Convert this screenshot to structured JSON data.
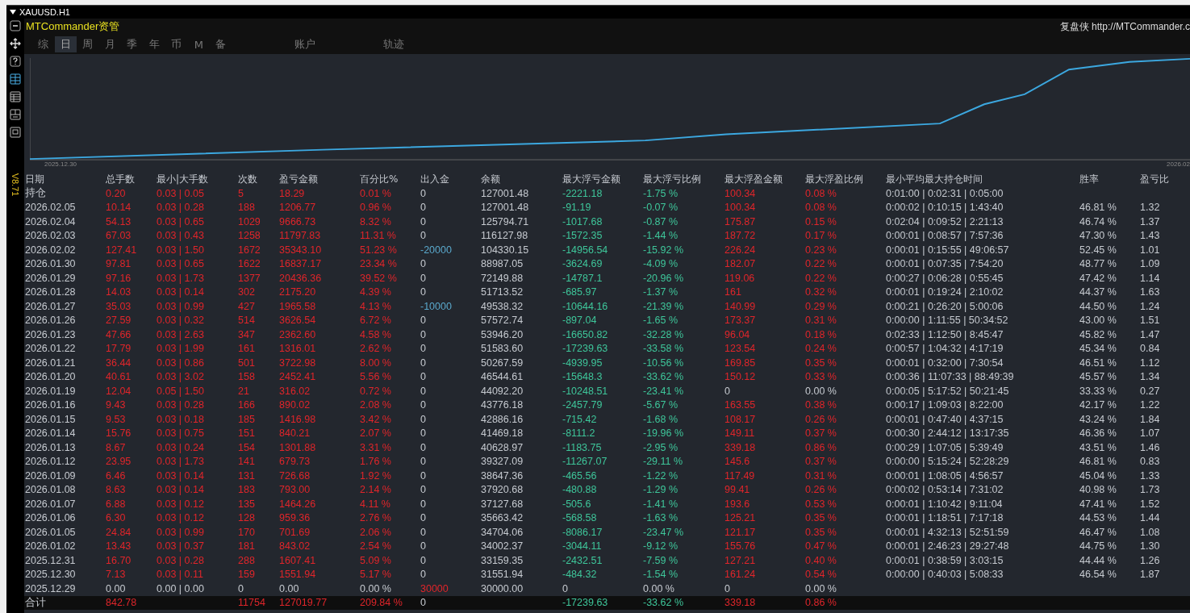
{
  "window": {
    "title": "XAUUSD.H1"
  },
  "panel": {
    "title": "MTCommander资管",
    "brand": "复盘侠 http://MTCommander.c",
    "version": "V8.71"
  },
  "tabs": [
    {
      "label": "综",
      "selected": false
    },
    {
      "label": "日",
      "selected": true
    },
    {
      "label": "周",
      "selected": false
    },
    {
      "label": "月",
      "selected": false
    },
    {
      "label": "季",
      "selected": false
    },
    {
      "label": "年",
      "selected": false
    },
    {
      "label": "币",
      "selected": false
    },
    {
      "label": "M",
      "selected": false
    },
    {
      "label": "备",
      "selected": false
    }
  ],
  "sections": [
    {
      "label": "账户",
      "selected": false
    },
    {
      "label": "轨迹",
      "selected": false
    }
  ],
  "chart": {
    "start_label": "2025.12.30",
    "end_label": "2026.02"
  },
  "table": {
    "columns": [
      "日期",
      "总手数",
      "最小|大手数",
      "次数",
      "盈亏金额",
      "百分比%",
      "出入金",
      "余额",
      "最大浮亏金额",
      "最大浮亏比例",
      "最大浮盈金额",
      "最大浮盈比例",
      "最小平均最大持仓时间",
      "胜率",
      "盈亏比"
    ],
    "rows": [
      {
        "kind": "open",
        "profit": true,
        "float_loss": true,
        "float_gain": true,
        "withdrawal": false,
        "deposit": false,
        "cells": [
          "持仓",
          "0.20",
          "0.03 | 0.05",
          "5",
          "18.29",
          "0.01 %",
          "0",
          "127001.48",
          "-2221.18",
          "-1.75 %",
          "100.34",
          "0.08 %",
          "0:01:00 | 0:02:31 | 0:05:00",
          null,
          null
        ]
      },
      {
        "kind": "day",
        "profit": true,
        "float_loss": true,
        "float_gain": true,
        "withdrawal": false,
        "deposit": false,
        "cells": [
          "2026.02.05",
          "10.14",
          "0.03 | 0.28",
          "188",
          "1206.77",
          "0.96 %",
          "0",
          "127001.48",
          "-91.19",
          "-0.07 %",
          "100.34",
          "0.08 %",
          "0:00:02 | 0:10:15 | 1:43:40",
          "46.81 %",
          "1.32"
        ]
      },
      {
        "kind": "day",
        "profit": true,
        "float_loss": true,
        "float_gain": true,
        "withdrawal": false,
        "deposit": false,
        "cells": [
          "2026.02.04",
          "54.13",
          "0.03 | 0.65",
          "1029",
          "9666.73",
          "8.32 %",
          "0",
          "125794.71",
          "-1017.68",
          "-0.87 %",
          "175.87",
          "0.15 %",
          "0:02:04 | 0:09:52 | 2:21:13",
          "46.74 %",
          "1.37"
        ]
      },
      {
        "kind": "day",
        "profit": true,
        "float_loss": true,
        "float_gain": true,
        "withdrawal": false,
        "deposit": false,
        "cells": [
          "2026.02.03",
          "67.03",
          "0.03 | 0.43",
          "1258",
          "11797.83",
          "11.31 %",
          "0",
          "116127.98",
          "-1572.35",
          "-1.44 %",
          "187.72",
          "0.17 %",
          "0:00:01 | 0:08:57 | 7:57:36",
          "47.30 %",
          "1.43"
        ]
      },
      {
        "kind": "day",
        "profit": true,
        "float_loss": true,
        "float_gain": true,
        "withdrawal": true,
        "deposit": false,
        "cells": [
          "2026.02.02",
          "127.41",
          "0.03 | 1.50",
          "1672",
          "35343.10",
          "51.23 %",
          "-20000",
          "104330.15",
          "-14956.54",
          "-15.92 %",
          "226.24",
          "0.23 %",
          "0:00:01 | 0:15:55 | 49:06:57",
          "52.45 %",
          "1.01"
        ]
      },
      {
        "kind": "day",
        "profit": true,
        "float_loss": true,
        "float_gain": true,
        "withdrawal": false,
        "deposit": false,
        "cells": [
          "2026.01.30",
          "97.81",
          "0.03 | 0.65",
          "1622",
          "16837.17",
          "23.34 %",
          "0",
          "88987.05",
          "-3624.69",
          "-4.09 %",
          "182.07",
          "0.22 %",
          "0:00:01 | 0:07:35 | 7:54:20",
          "48.77 %",
          "1.09"
        ]
      },
      {
        "kind": "day",
        "profit": true,
        "float_loss": true,
        "float_gain": true,
        "withdrawal": false,
        "deposit": false,
        "cells": [
          "2026.01.29",
          "97.16",
          "0.03 | 1.73",
          "1377",
          "20436.36",
          "39.52 %",
          "0",
          "72149.88",
          "-14787.1",
          "-20.96 %",
          "119.06",
          "0.22 %",
          "0:00:27 | 0:06:28 | 0:55:45",
          "47.42 %",
          "1.14"
        ]
      },
      {
        "kind": "day",
        "profit": true,
        "float_loss": true,
        "float_gain": true,
        "withdrawal": false,
        "deposit": false,
        "cells": [
          "2026.01.28",
          "14.03",
          "0.03 | 0.14",
          "302",
          "2175.20",
          "4.39 %",
          "0",
          "51713.52",
          "-685.97",
          "-1.37 %",
          "161",
          "0.32 %",
          "0:00:01 | 0:19:24 | 2:10:02",
          "44.37 %",
          "1.63"
        ]
      },
      {
        "kind": "day",
        "profit": true,
        "float_loss": true,
        "float_gain": true,
        "withdrawal": true,
        "deposit": false,
        "cells": [
          "2026.01.27",
          "35.03",
          "0.03 | 0.99",
          "427",
          "1965.58",
          "4.13 %",
          "-10000",
          "49538.32",
          "-10644.16",
          "-21.39 %",
          "140.99",
          "0.29 %",
          "0:00:21 | 0:26:20 | 5:00:06",
          "44.50 %",
          "1.24"
        ]
      },
      {
        "kind": "day",
        "profit": true,
        "float_loss": true,
        "float_gain": true,
        "withdrawal": false,
        "deposit": false,
        "cells": [
          "2026.01.26",
          "27.59",
          "0.03 | 0.32",
          "514",
          "3626.54",
          "6.72 %",
          "0",
          "57572.74",
          "-897.04",
          "-1.65 %",
          "173.37",
          "0.31 %",
          "0:00:00 | 1:11:55 | 50:34:52",
          "43.00 %",
          "1.51"
        ]
      },
      {
        "kind": "day",
        "profit": true,
        "float_loss": true,
        "float_gain": true,
        "withdrawal": false,
        "deposit": false,
        "cells": [
          "2026.01.23",
          "47.66",
          "0.03 | 2.63",
          "347",
          "2362.60",
          "4.58 %",
          "0",
          "53946.20",
          "-16650.82",
          "-32.28 %",
          "96.04",
          "0.18 %",
          "0:02:33 | 1:12:50 | 8:45:47",
          "45.82 %",
          "1.47"
        ]
      },
      {
        "kind": "day",
        "profit": true,
        "float_loss": true,
        "float_gain": true,
        "withdrawal": false,
        "deposit": false,
        "cells": [
          "2026.01.22",
          "17.79",
          "0.03 | 1.99",
          "161",
          "1316.01",
          "2.62 %",
          "0",
          "51583.60",
          "-17239.63",
          "-33.58 %",
          "123.54",
          "0.24 %",
          "0:00:57 | 1:04:32 | 4:17:19",
          "45.34 %",
          "0.84"
        ]
      },
      {
        "kind": "day",
        "profit": true,
        "float_loss": true,
        "float_gain": true,
        "withdrawal": false,
        "deposit": false,
        "cells": [
          "2026.01.21",
          "36.44",
          "0.03 | 0.86",
          "501",
          "3722.98",
          "8.00 %",
          "0",
          "50267.59",
          "-4939.95",
          "-10.56 %",
          "169.85",
          "0.35 %",
          "0:00:01 | 0:32:00 | 7:30:54",
          "46.51 %",
          "1.12"
        ]
      },
      {
        "kind": "day",
        "profit": true,
        "float_loss": true,
        "float_gain": true,
        "withdrawal": false,
        "deposit": false,
        "cells": [
          "2026.01.20",
          "40.61",
          "0.03 | 3.02",
          "158",
          "2452.41",
          "5.56 %",
          "0",
          "46544.61",
          "-15648.3",
          "-33.62 %",
          "150.12",
          "0.33 %",
          "0:00:36 | 11:07:33 | 88:49:39",
          "45.57 %",
          "1.34"
        ]
      },
      {
        "kind": "day",
        "profit": true,
        "float_loss": true,
        "float_gain": false,
        "withdrawal": false,
        "deposit": false,
        "cells": [
          "2026.01.19",
          "12.04",
          "0.05 | 1.50",
          "21",
          "316.02",
          "0.72 %",
          "0",
          "44092.20",
          "-10248.51",
          "-23.41 %",
          "0",
          "0.00 %",
          "0:00:05 | 5:17:52 | 50:21:45",
          "33.33 %",
          "0.27"
        ]
      },
      {
        "kind": "day",
        "profit": true,
        "float_loss": true,
        "float_gain": true,
        "withdrawal": false,
        "deposit": false,
        "cells": [
          "2026.01.16",
          "9.43",
          "0.03 | 0.28",
          "166",
          "890.02",
          "2.08 %",
          "0",
          "43776.18",
          "-2457.79",
          "-5.67 %",
          "163.55",
          "0.38 %",
          "0:00:17 | 1:09:03 | 8:22:00",
          "42.17 %",
          "1.22"
        ]
      },
      {
        "kind": "day",
        "profit": true,
        "float_loss": true,
        "float_gain": true,
        "withdrawal": false,
        "deposit": false,
        "cells": [
          "2026.01.15",
          "9.53",
          "0.03 | 0.18",
          "185",
          "1416.98",
          "3.42 %",
          "0",
          "42886.16",
          "-715.42",
          "-1.68 %",
          "108.17",
          "0.26 %",
          "0:00:01 | 0:47:40 | 4:37:15",
          "43.24 %",
          "1.84"
        ]
      },
      {
        "kind": "day",
        "profit": true,
        "float_loss": true,
        "float_gain": true,
        "withdrawal": false,
        "deposit": false,
        "cells": [
          "2026.01.14",
          "15.76",
          "0.03 | 0.75",
          "151",
          "840.21",
          "2.07 %",
          "0",
          "41469.18",
          "-8111.2",
          "-19.96 %",
          "149.11",
          "0.37 %",
          "0:00:30 | 2:44:12 | 13:17:35",
          "46.36 %",
          "1.07"
        ]
      },
      {
        "kind": "day",
        "profit": true,
        "float_loss": true,
        "float_gain": true,
        "withdrawal": false,
        "deposit": false,
        "cells": [
          "2026.01.13",
          "8.67",
          "0.03 | 0.24",
          "154",
          "1301.88",
          "3.31 %",
          "0",
          "40628.97",
          "-1183.75",
          "-2.95 %",
          "339.18",
          "0.86 %",
          "0:00:29 | 1:07:05 | 5:39:49",
          "43.51 %",
          "1.46"
        ]
      },
      {
        "kind": "day",
        "profit": true,
        "float_loss": true,
        "float_gain": true,
        "withdrawal": false,
        "deposit": false,
        "cells": [
          "2026.01.12",
          "23.95",
          "0.03 | 1.73",
          "141",
          "679.73",
          "1.76 %",
          "0",
          "39327.09",
          "-11267.07",
          "-29.11 %",
          "145.6",
          "0.37 %",
          "0:00:00 | 5:15:24 | 52:28:29",
          "46.81 %",
          "0.83"
        ]
      },
      {
        "kind": "day",
        "profit": true,
        "float_loss": true,
        "float_gain": true,
        "withdrawal": false,
        "deposit": false,
        "cells": [
          "2026.01.09",
          "6.46",
          "0.03 | 0.14",
          "131",
          "726.68",
          "1.92 %",
          "0",
          "38647.36",
          "-465.56",
          "-1.22 %",
          "117.49",
          "0.31 %",
          "0:00:01 | 1:08:05 | 4:56:57",
          "45.04 %",
          "1.33"
        ]
      },
      {
        "kind": "day",
        "profit": true,
        "float_loss": true,
        "float_gain": true,
        "withdrawal": false,
        "deposit": false,
        "cells": [
          "2026.01.08",
          "8.63",
          "0.03 | 0.14",
          "183",
          "793.00",
          "2.14 %",
          "0",
          "37920.68",
          "-480.88",
          "-1.29 %",
          "99.41",
          "0.26 %",
          "0:00:02 | 0:53:14 | 7:31:02",
          "40.98 %",
          "1.73"
        ]
      },
      {
        "kind": "day",
        "profit": true,
        "float_loss": true,
        "float_gain": true,
        "withdrawal": false,
        "deposit": false,
        "cells": [
          "2026.01.07",
          "6.88",
          "0.03 | 0.12",
          "135",
          "1464.26",
          "4.11 %",
          "0",
          "37127.68",
          "-505.6",
          "-1.41 %",
          "193.6",
          "0.53 %",
          "0:00:01 | 1:10:42 | 9:11:04",
          "47.41 %",
          "1.52"
        ]
      },
      {
        "kind": "day",
        "profit": true,
        "float_loss": true,
        "float_gain": true,
        "withdrawal": false,
        "deposit": false,
        "cells": [
          "2026.01.06",
          "6.30",
          "0.03 | 0.12",
          "128",
          "959.36",
          "2.76 %",
          "0",
          "35663.42",
          "-568.58",
          "-1.63 %",
          "125.21",
          "0.35 %",
          "0:00:01 | 1:18:51 | 7:17:18",
          "44.53 %",
          "1.44"
        ]
      },
      {
        "kind": "day",
        "profit": true,
        "float_loss": true,
        "float_gain": true,
        "withdrawal": false,
        "deposit": false,
        "cells": [
          "2026.01.05",
          "24.84",
          "0.03 | 0.99",
          "170",
          "701.69",
          "2.06 %",
          "0",
          "34704.06",
          "-8086.17",
          "-23.47 %",
          "121.17",
          "0.35 %",
          "0:00:01 | 4:32:13 | 52:51:59",
          "46.47 %",
          "1.08"
        ]
      },
      {
        "kind": "day",
        "profit": true,
        "float_loss": true,
        "float_gain": true,
        "withdrawal": false,
        "deposit": false,
        "cells": [
          "2026.01.02",
          "13.43",
          "0.03 | 0.37",
          "181",
          "843.02",
          "2.54 %",
          "0",
          "34002.37",
          "-3044.11",
          "-9.12 %",
          "155.76",
          "0.47 %",
          "0:00:01 | 2:46:23 | 29:27:48",
          "44.75 %",
          "1.30"
        ]
      },
      {
        "kind": "day",
        "profit": true,
        "float_loss": true,
        "float_gain": true,
        "withdrawal": false,
        "deposit": false,
        "cells": [
          "2025.12.31",
          "16.70",
          "0.03 | 0.28",
          "288",
          "1607.41",
          "5.09 %",
          "0",
          "33159.35",
          "-2432.51",
          "-7.59 %",
          "127.21",
          "0.40 %",
          "0:00:01 | 0:38:59 | 3:03:15",
          "44.44 %",
          "1.26"
        ]
      },
      {
        "kind": "day",
        "profit": true,
        "float_loss": true,
        "float_gain": true,
        "withdrawal": false,
        "deposit": false,
        "cells": [
          "2025.12.30",
          "7.13",
          "0.03 | 0.11",
          "159",
          "1551.94",
          "5.17 %",
          "0",
          "31551.94",
          "-484.32",
          "-1.54 %",
          "161.24",
          "0.54 %",
          "0:00:00 | 0:40:03 | 5:08:33",
          "46.54 %",
          "1.87"
        ]
      },
      {
        "kind": "day",
        "profit": false,
        "float_loss": false,
        "float_gain": false,
        "withdrawal": false,
        "deposit": true,
        "cells": [
          "2025.12.29",
          "0.00",
          "0.00 | 0.00",
          "0",
          "0.00",
          "0.00 %",
          "30000",
          "30000.00",
          "0",
          "0.00 %",
          "0",
          "0.00 %",
          null,
          null,
          null
        ]
      },
      {
        "kind": "total",
        "profit": true,
        "float_loss": true,
        "float_gain": true,
        "withdrawal": false,
        "deposit": false,
        "cells": [
          "合计",
          "842.78",
          null,
          "11754",
          "127019.77",
          "209.84 %",
          "0",
          null,
          "-17239.63",
          "-33.62 %",
          "339.18",
          "0.86 %",
          null,
          null,
          null
        ]
      }
    ]
  }
}
